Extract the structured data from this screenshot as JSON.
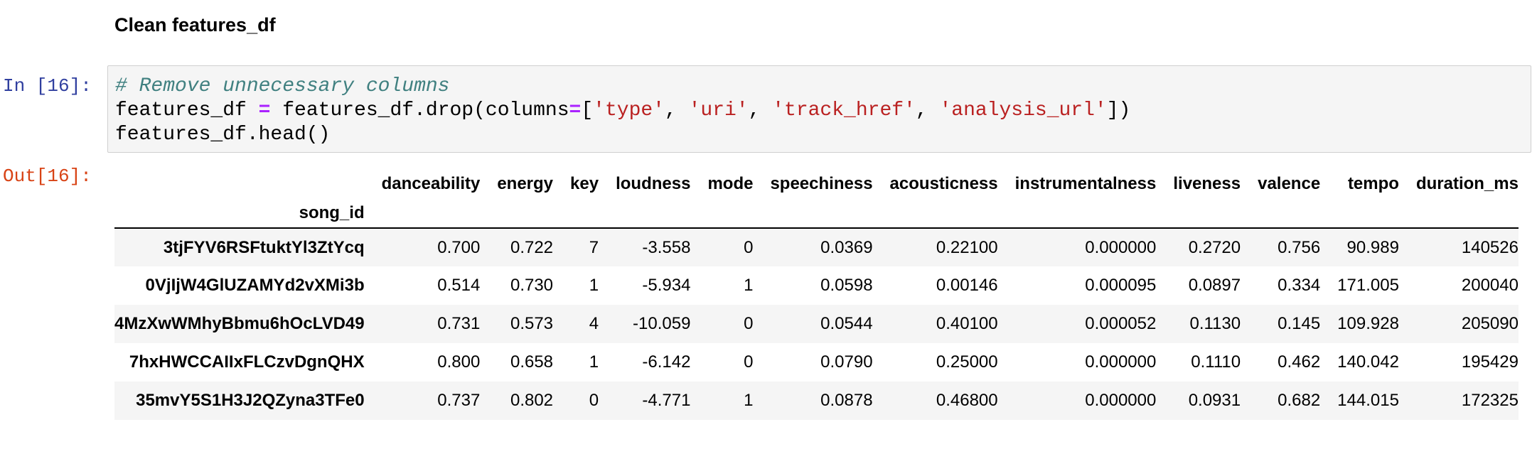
{
  "markdown": {
    "heading": "Clean features_df"
  },
  "cell": {
    "in_prompt": "In [16]:",
    "out_prompt": "Out[16]:",
    "code": {
      "comment": "# Remove unnecessary columns",
      "line2_var": "features_df ",
      "line2_op": "=",
      "line2_call": " features_df.drop(columns",
      "line2_eq": "=",
      "line2_open": "[",
      "str1": "'type'",
      "str2": "'uri'",
      "str3": "'track_href'",
      "str4": "'analysis_url'",
      "comma": ", ",
      "line2_close": "])",
      "line3": "features_df.head()"
    }
  },
  "table": {
    "index_name": "song_id",
    "columns": [
      "danceability",
      "energy",
      "key",
      "loudness",
      "mode",
      "speechiness",
      "acousticness",
      "instrumentalness",
      "liveness",
      "valence",
      "tempo",
      "duration_ms"
    ],
    "rows": [
      {
        "index": "3tjFYV6RSFtuktYl3ZtYcq",
        "values": [
          "0.700",
          "0.722",
          "7",
          "-3.558",
          "0",
          "0.0369",
          "0.22100",
          "0.000000",
          "0.2720",
          "0.756",
          "90.989",
          "140526"
        ]
      },
      {
        "index": "0VjIjW4GlUZAMYd2vXMi3b",
        "values": [
          "0.514",
          "0.730",
          "1",
          "-5.934",
          "1",
          "0.0598",
          "0.00146",
          "0.000095",
          "0.0897",
          "0.334",
          "171.005",
          "200040"
        ]
      },
      {
        "index": "4MzXwWMhyBbmu6hOcLVD49",
        "values": [
          "0.731",
          "0.573",
          "4",
          "-10.059",
          "0",
          "0.0544",
          "0.40100",
          "0.000052",
          "0.1130",
          "0.145",
          "109.928",
          "205090"
        ]
      },
      {
        "index": "7hxHWCCAIIxFLCzvDgnQHX",
        "values": [
          "0.800",
          "0.658",
          "1",
          "-6.142",
          "0",
          "0.0790",
          "0.25000",
          "0.000000",
          "0.1110",
          "0.462",
          "140.042",
          "195429"
        ]
      },
      {
        "index": "35mvY5S1H3J2QZyna3TFe0",
        "values": [
          "0.737",
          "0.802",
          "0",
          "-4.771",
          "1",
          "0.0878",
          "0.46800",
          "0.000000",
          "0.0931",
          "0.682",
          "144.015",
          "172325"
        ]
      }
    ]
  }
}
